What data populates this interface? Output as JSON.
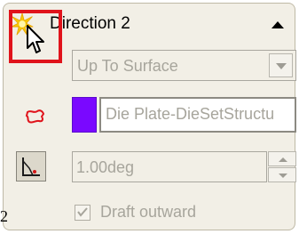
{
  "header": {
    "title": "Direction 2",
    "collapse_icon": "chevron-up-icon",
    "enable_icon": "starburst-checkbox-icon"
  },
  "end_condition": {
    "value": "Up To Surface",
    "dropdown_icon": "chevron-down-icon"
  },
  "face": {
    "icon": "face-selection-icon",
    "swatch_color": "#7a08ff",
    "value": "Die Plate-DieSetStructu"
  },
  "draft": {
    "icon": "draft-angle-icon",
    "value": "1.00deg",
    "outward_label": "Draft outward",
    "outward_checked": true
  },
  "side_label": "2",
  "colors": {
    "highlight": "#e0131b",
    "panel_bg": "#f2efe6",
    "disabled_text": "#a7a59c"
  }
}
